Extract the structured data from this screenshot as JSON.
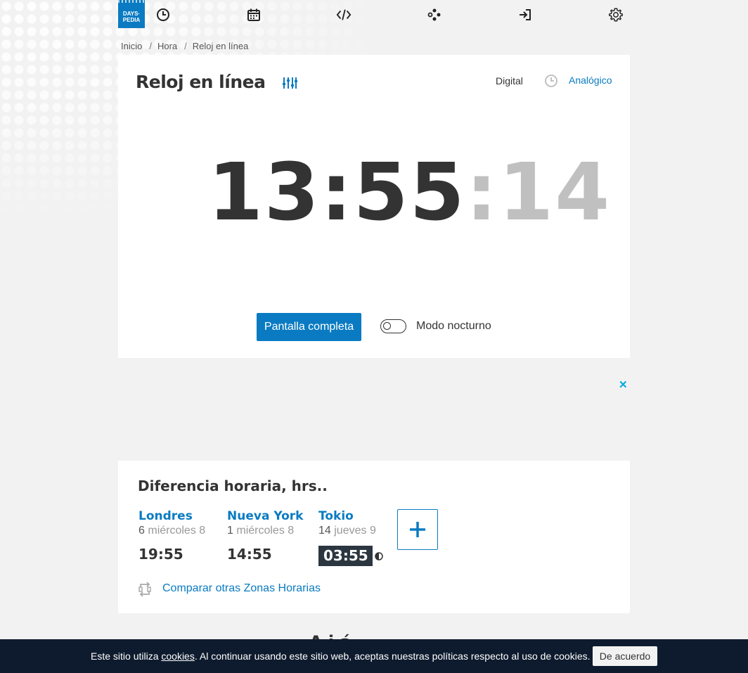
{
  "header": {
    "logo_line1": "DAYS·",
    "logo_line2": "PEDIA",
    "nav_icons": [
      "clock-icon",
      "calendar-icon",
      "code-icon",
      "gamepad-icon",
      "login-icon",
      "gear-icon"
    ]
  },
  "breadcrumb": {
    "items": [
      "Inicio",
      "Hora",
      "Reloj en línea"
    ],
    "separator": "/"
  },
  "clock": {
    "title": "Reloj en línea",
    "mode_digital": "Digital",
    "mode_analog": "Analógico",
    "time_hm": "13:55",
    "time_sec": ":14",
    "fullscreen_label": "Pantalla completa",
    "night_mode_label": "Modo nocturno",
    "night_mode_on": false
  },
  "ad": {
    "close_symbol": "✕"
  },
  "time_difference": {
    "title": "Diferencia horaria, hrs..",
    "cities": [
      {
        "name": "Londres",
        "day_num": "6",
        "day_text": "miércoles 8",
        "time": "19:55",
        "night": false
      },
      {
        "name": "Nueva York",
        "day_num": "1",
        "day_text": "miércoles 8",
        "time": "14:55",
        "night": false
      },
      {
        "name": "Tokio",
        "day_num": "14",
        "day_text": "jueves 9",
        "time": "03:55",
        "night": true
      }
    ],
    "compare_label": "Comparar otras Zonas Horarias"
  },
  "below_heading_peek": "A   i   á",
  "cookie": {
    "text_before": "Este sitio utiliza ",
    "link": "cookies",
    "text_after": ". Al continuar usando este sitio web, aceptas nuestras políticas respecto al uso de cookies.",
    "button": "De acuerdo"
  },
  "colors": {
    "accent": "#0a7bc2",
    "text": "#333333",
    "seconds": "#c0c0c0",
    "background": "#f2f2f2",
    "cookie_bar": "#0e1b2e",
    "night_badge": "#2b3640"
  }
}
